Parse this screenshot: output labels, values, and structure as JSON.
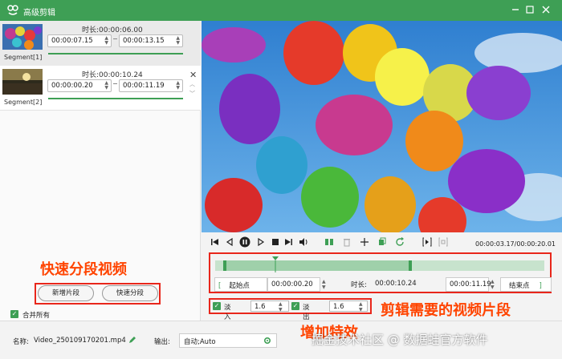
{
  "window": {
    "title": "高级剪辑"
  },
  "segments": [
    {
      "label": "Segment[1]",
      "duration_label": "时长:",
      "duration": "00:00:06.00",
      "start": "00:00:07.15",
      "end": "00:00:13.15"
    },
    {
      "label": "Segment[2]",
      "duration_label": "时长:",
      "duration": "00:00:10.24",
      "start": "00:00:00.20",
      "end": "00:00:11.19"
    }
  ],
  "left": {
    "add_segment": "新增片段",
    "quick_split": "快速分段",
    "merge_all": "合并所有",
    "merge_checked": true
  },
  "player": {
    "time_current": "00:00:03.17",
    "time_total": "00:00:20.01"
  },
  "trim": {
    "start_btn": "起始点",
    "start_time": "00:00:00.20",
    "duration_label": "时长:",
    "duration": "00:00:10.24",
    "end_time": "00:00:11.19",
    "end_btn": "结束点"
  },
  "effects": {
    "fade_in_label": "淡入",
    "fade_in_value": "1.6",
    "fade_in_checked": true,
    "fade_out_label": "淡出",
    "fade_out_value": "1.6",
    "fade_out_checked": true
  },
  "bottom": {
    "name_label": "名称:",
    "name_value": "Video_250109170201.mp4",
    "output_label": "输出:",
    "output_value": "自动;Auto"
  },
  "annotations": {
    "quick_split": "快速分段视频",
    "clip_segment": "剪辑需要的视频片段",
    "add_effects": "增加特效"
  },
  "watermark": "掘金技术社区 @ 数据蛙官方软件",
  "colors": {
    "brand_green": "#3e9f55",
    "annotation": "#ff4400",
    "highlight_box": "#e8261b"
  }
}
